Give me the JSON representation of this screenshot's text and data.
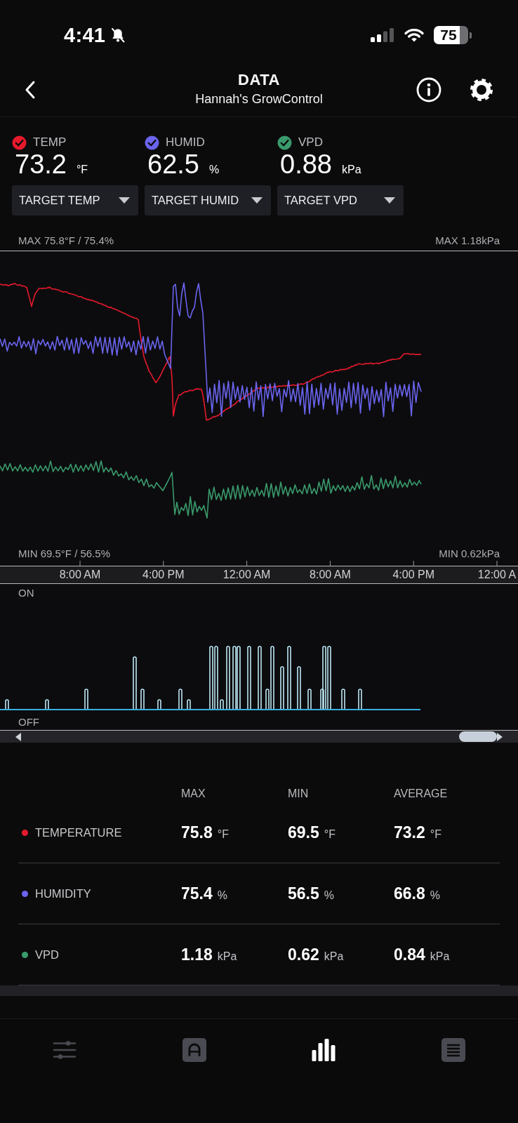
{
  "status_bar": {
    "time": "4:41",
    "battery": "75"
  },
  "header": {
    "title": "DATA",
    "subtitle": "Hannah's GrowControl"
  },
  "readings": [
    {
      "label": "TEMP",
      "value": "73.2",
      "unit": "°F",
      "color": "#e8192c",
      "checked": true,
      "target": "TARGET TEMP"
    },
    {
      "label": "HUMID",
      "value": "62.5",
      "unit": "%",
      "color": "#6a64ee",
      "checked": true,
      "target": "TARGET HUMID"
    },
    {
      "label": "VPD",
      "value": "0.88",
      "unit": "kPa",
      "color": "#3a9a6c",
      "checked": true,
      "target": "TARGET VPD"
    }
  ],
  "chart": {
    "max_left": "MAX 75.8°F / 75.4%",
    "max_right": "MAX 1.18kPa",
    "min_left": "MIN 69.5°F / 56.5%",
    "min_right": "MIN 0.62kPa",
    "time_labels": [
      "8:00 AM",
      "4:00 PM",
      "12:00 AM",
      "8:00 AM",
      "4:00 PM",
      "12:00 A"
    ]
  },
  "switch_chart": {
    "on_label": "ON",
    "off_label": "OFF"
  },
  "summary": {
    "columns": [
      "MAX",
      "MIN",
      "AVERAGE"
    ],
    "rows": [
      {
        "name": "TEMPERATURE",
        "color": "#e8192c",
        "cells": [
          {
            "value": "75.8",
            "unit": "°F"
          },
          {
            "value": "69.5",
            "unit": "°F"
          },
          {
            "value": "73.2",
            "unit": "°F"
          }
        ]
      },
      {
        "name": "HUMIDITY",
        "color": "#6a64ee",
        "cells": [
          {
            "value": "75.4",
            "unit": "%"
          },
          {
            "value": "56.5",
            "unit": "%"
          },
          {
            "value": "66.8",
            "unit": "%"
          }
        ]
      },
      {
        "name": "VPD",
        "color": "#3a9a6c",
        "cells": [
          {
            "value": "1.18",
            "unit": "kPa"
          },
          {
            "value": "0.62",
            "unit": "kPa"
          },
          {
            "value": "0.84",
            "unit": "kPa"
          }
        ]
      }
    ]
  },
  "nav_tabs": [
    {
      "selected": false
    },
    {
      "selected": false
    },
    {
      "selected": true
    },
    {
      "selected": false
    }
  ]
}
